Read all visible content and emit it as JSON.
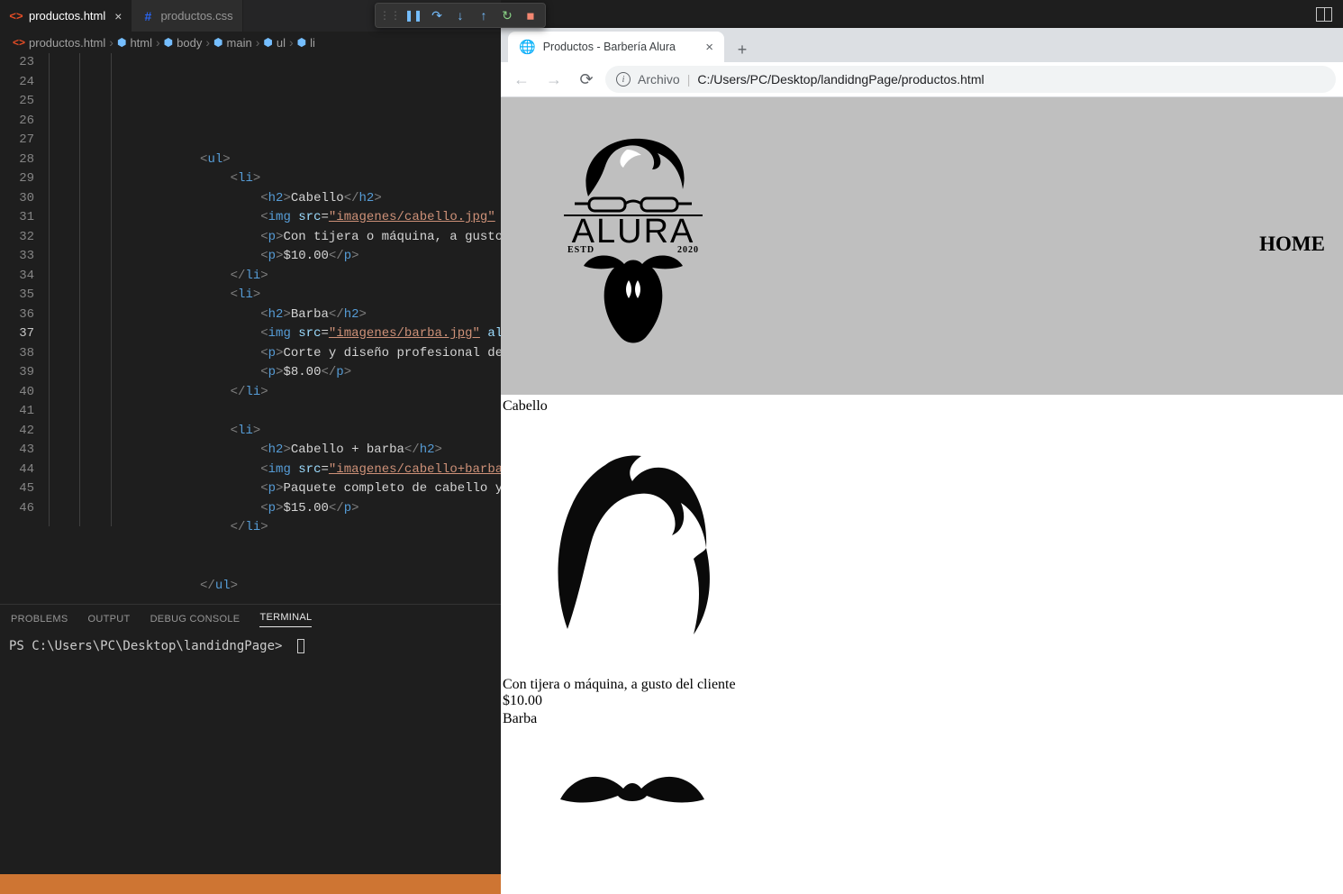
{
  "editor": {
    "tabs": [
      {
        "name": "productos.html",
        "active": true,
        "icon": "html"
      },
      {
        "name": "productos.css",
        "active": false,
        "icon": "css"
      }
    ],
    "breadcrumbs": [
      "productos.html",
      "html",
      "body",
      "main",
      "ul",
      "li"
    ],
    "lines": {
      "start": 23,
      "current": 37,
      "code": [
        {
          "n": 23,
          "indent": 5,
          "tokens": [
            [
              "bracket",
              "<"
            ],
            [
              "tag",
              "ul"
            ],
            [
              "bracket",
              ">"
            ]
          ]
        },
        {
          "n": 24,
          "indent": 6,
          "tokens": [
            [
              "bracket",
              "<"
            ],
            [
              "tag",
              "li"
            ],
            [
              "bracket",
              ">"
            ]
          ]
        },
        {
          "n": 25,
          "indent": 7,
          "tokens": [
            [
              "bracket",
              "<"
            ],
            [
              "tag",
              "h2"
            ],
            [
              "bracket",
              ">"
            ],
            [
              "txt",
              "Cabello"
            ],
            [
              "bracket",
              "</"
            ],
            [
              "tag",
              "h2"
            ],
            [
              "bracket",
              ">"
            ]
          ]
        },
        {
          "n": 26,
          "indent": 7,
          "tokens": [
            [
              "bracket",
              "<"
            ],
            [
              "tag",
              "img"
            ],
            [
              "txt",
              " "
            ],
            [
              "attr",
              "src"
            ],
            [
              "txt",
              "="
            ],
            [
              "strU",
              "\"imagenes/cabello.jpg\""
            ],
            [
              "txt",
              " "
            ],
            [
              "attr",
              "alt"
            ],
            [
              "txt",
              "="
            ]
          ]
        },
        {
          "n": 27,
          "indent": 7,
          "tokens": [
            [
              "bracket",
              "<"
            ],
            [
              "tag",
              "p"
            ],
            [
              "bracket",
              ">"
            ],
            [
              "txt",
              "Con tijera o máquina, a gusto del"
            ]
          ]
        },
        {
          "n": 28,
          "indent": 7,
          "tokens": [
            [
              "bracket",
              "<"
            ],
            [
              "tag",
              "p"
            ],
            [
              "bracket",
              ">"
            ],
            [
              "txt",
              "$10.00"
            ],
            [
              "bracket",
              "</"
            ],
            [
              "tag",
              "p"
            ],
            [
              "bracket",
              ">"
            ]
          ]
        },
        {
          "n": 29,
          "indent": 6,
          "tokens": [
            [
              "bracket",
              "</"
            ],
            [
              "tag",
              "li"
            ],
            [
              "bracket",
              ">"
            ]
          ]
        },
        {
          "n": 30,
          "indent": 6,
          "tokens": [
            [
              "bracket",
              "<"
            ],
            [
              "tag",
              "li"
            ],
            [
              "bracket",
              ">"
            ]
          ]
        },
        {
          "n": 31,
          "indent": 7,
          "tokens": [
            [
              "bracket",
              "<"
            ],
            [
              "tag",
              "h2"
            ],
            [
              "bracket",
              ">"
            ],
            [
              "txt",
              "Barba"
            ],
            [
              "bracket",
              "</"
            ],
            [
              "tag",
              "h2"
            ],
            [
              "bracket",
              ">"
            ]
          ]
        },
        {
          "n": 32,
          "indent": 7,
          "tokens": [
            [
              "bracket",
              "<"
            ],
            [
              "tag",
              "img"
            ],
            [
              "txt",
              " "
            ],
            [
              "attr",
              "src"
            ],
            [
              "txt",
              "="
            ],
            [
              "strU",
              "\"imagenes/barba.jpg\""
            ],
            [
              "txt",
              " "
            ],
            [
              "attr",
              "alt"
            ],
            [
              "txt",
              "="
            ],
            [
              "str",
              "\"b"
            ]
          ]
        },
        {
          "n": 33,
          "indent": 7,
          "tokens": [
            [
              "bracket",
              "<"
            ],
            [
              "tag",
              "p"
            ],
            [
              "bracket",
              ">"
            ],
            [
              "txt",
              "Corte y diseño profesional de bar"
            ]
          ]
        },
        {
          "n": 34,
          "indent": 7,
          "tokens": [
            [
              "bracket",
              "<"
            ],
            [
              "tag",
              "p"
            ],
            [
              "bracket",
              ">"
            ],
            [
              "txt",
              "$8.00"
            ],
            [
              "bracket",
              "</"
            ],
            [
              "tag",
              "p"
            ],
            [
              "bracket",
              ">"
            ]
          ]
        },
        {
          "n": 35,
          "indent": 6,
          "tokens": [
            [
              "bracket",
              "</"
            ],
            [
              "tag",
              "li"
            ],
            [
              "bracket",
              ">"
            ]
          ]
        },
        {
          "n": 36,
          "indent": 0,
          "tokens": []
        },
        {
          "n": 37,
          "indent": 6,
          "tokens": [
            [
              "bracket",
              "<"
            ],
            [
              "tag",
              "li"
            ],
            [
              "bracket",
              ">"
            ]
          ]
        },
        {
          "n": 38,
          "indent": 7,
          "tokens": [
            [
              "bracket",
              "<"
            ],
            [
              "tag",
              "h2"
            ],
            [
              "bracket",
              ">"
            ],
            [
              "txt",
              "Cabello + barba"
            ],
            [
              "bracket",
              "</"
            ],
            [
              "tag",
              "h2"
            ],
            [
              "bracket",
              ">"
            ]
          ]
        },
        {
          "n": 39,
          "indent": 7,
          "tokens": [
            [
              "bracket",
              "<"
            ],
            [
              "tag",
              "img"
            ],
            [
              "txt",
              " "
            ],
            [
              "attr",
              "src"
            ],
            [
              "txt",
              "="
            ],
            [
              "strU",
              "\"imagenes/cabello+barba.jpg"
            ]
          ]
        },
        {
          "n": 40,
          "indent": 7,
          "tokens": [
            [
              "bracket",
              "<"
            ],
            [
              "tag",
              "p"
            ],
            [
              "bracket",
              ">"
            ],
            [
              "txt",
              "Paquete completo de cabello y bar"
            ]
          ]
        },
        {
          "n": 41,
          "indent": 7,
          "tokens": [
            [
              "bracket",
              "<"
            ],
            [
              "tag",
              "p"
            ],
            [
              "bracket",
              ">"
            ],
            [
              "txt",
              "$15.00"
            ],
            [
              "bracket",
              "</"
            ],
            [
              "tag",
              "p"
            ],
            [
              "bracket",
              ">"
            ]
          ]
        },
        {
          "n": 42,
          "indent": 6,
          "tokens": [
            [
              "bracket",
              "</"
            ],
            [
              "tag",
              "li"
            ],
            [
              "bracket",
              ">"
            ]
          ]
        },
        {
          "n": 43,
          "indent": 0,
          "tokens": []
        },
        {
          "n": 44,
          "indent": 0,
          "tokens": []
        },
        {
          "n": 45,
          "indent": 5,
          "tokens": [
            [
              "bracket",
              "</"
            ],
            [
              "tag",
              "ul"
            ],
            [
              "bracket",
              ">"
            ]
          ]
        },
        {
          "n": 46,
          "indent": 0,
          "tokens": []
        }
      ]
    }
  },
  "panel": {
    "tabs": [
      "PROBLEMS",
      "OUTPUT",
      "DEBUG CONSOLE",
      "TERMINAL"
    ],
    "active": "TERMINAL",
    "terminal_prompt": "PS C:\\Users\\PC\\Desktop\\landidngPage>"
  },
  "browser": {
    "tab_title": "Productos - Barbería Alura",
    "scheme_label": "Archivo",
    "url": "C:/Users/PC/Desktop/landidngPage/productos.html",
    "home_link": "HOME",
    "logo": {
      "brand": "ALURA",
      "left": "ESTD",
      "right": "2020"
    },
    "products": [
      {
        "title": "Cabello",
        "desc": "Con tijera o máquina, a gusto del cliente",
        "price": "$10.00"
      },
      {
        "title": "Barba",
        "desc": "Corte y diseño profesional de barba",
        "price": "$8.00"
      },
      {
        "title": "Cabello + barba",
        "desc": "Paquete completo de cabello y barba",
        "price": "$15.00"
      }
    ]
  }
}
